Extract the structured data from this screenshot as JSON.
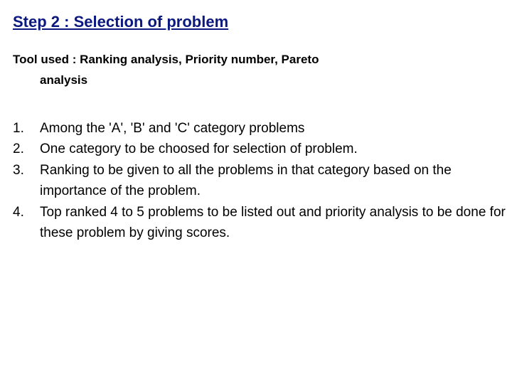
{
  "heading": "Step 2 :  Selection of problem",
  "tool_line1": "Tool used : Ranking analysis, Priority number, Pareto",
  "tool_line2": "analysis",
  "items": [
    {
      "num": "1.",
      "txt": "Among the 'A', 'B' and 'C' category problems"
    },
    {
      "num": "2.",
      "txt": "One category to be choosed for selection of problem."
    },
    {
      "num": "3.",
      "txt": "Ranking to be given to all the problems in that category based on the importance of the problem."
    },
    {
      "num": "4.",
      "txt": "Top ranked 4 to 5 problems to be listed out and priority analysis to be done for these problem by giving scores."
    }
  ]
}
